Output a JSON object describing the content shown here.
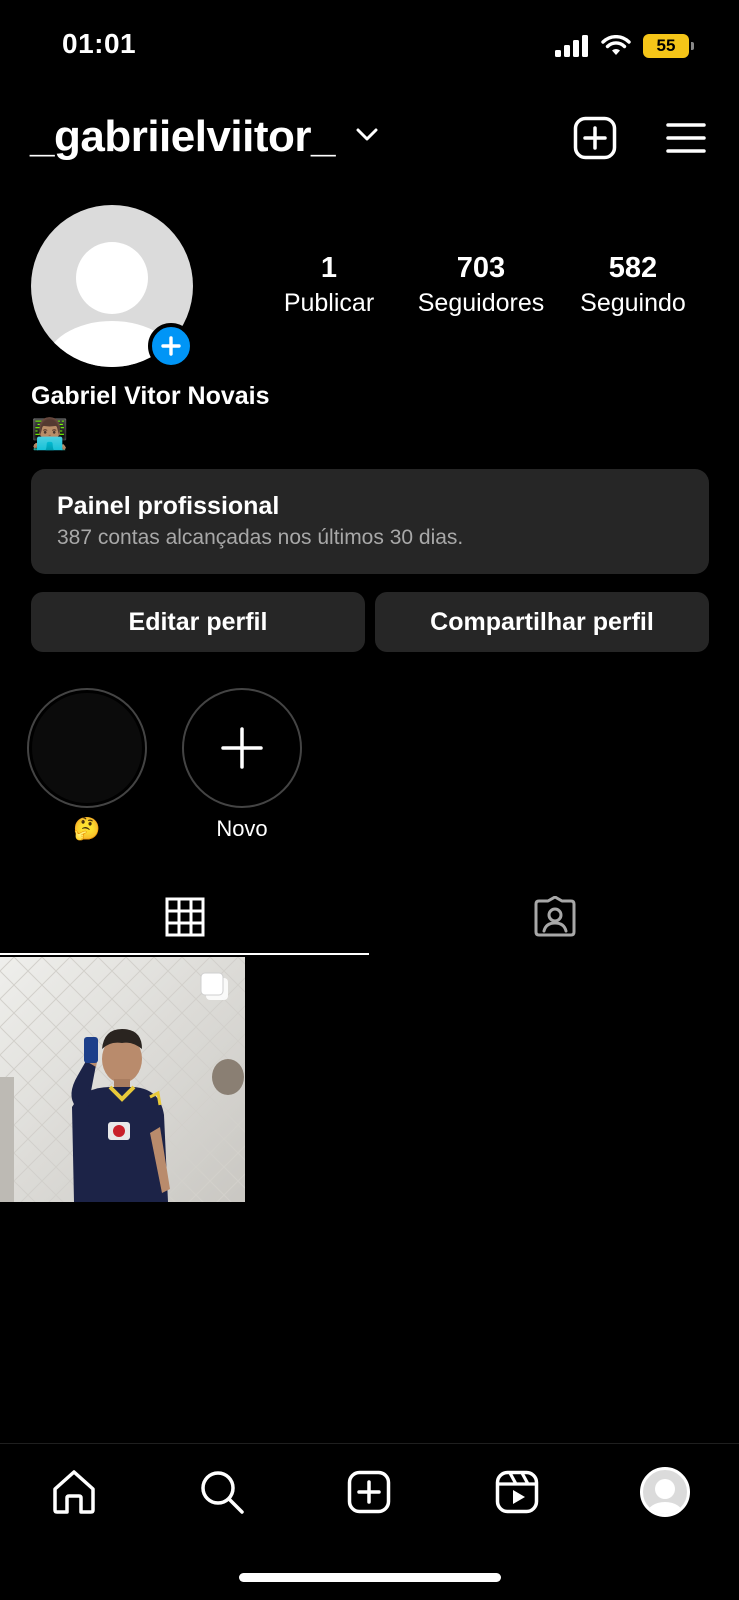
{
  "status_bar": {
    "time": "01:01",
    "battery": "55"
  },
  "header": {
    "username": "_gabriielviitor_"
  },
  "profile": {
    "name": "Gabriel Vitor Novais",
    "bio": "👨🏽‍💻",
    "stats": [
      {
        "value": "1",
        "label": "Publicar"
      },
      {
        "value": "703",
        "label": "Seguidores"
      },
      {
        "value": "582",
        "label": "Seguindo"
      }
    ]
  },
  "panel": {
    "title": "Painel profissional",
    "subtitle": "387 contas alcançadas nos últimos 30 dias."
  },
  "buttons": {
    "edit": "Editar perfil",
    "share": "Compartilhar perfil"
  },
  "highlights": [
    {
      "label": "🤔"
    },
    {
      "label": "Novo"
    }
  ],
  "tabs": [
    {
      "icon": "grid-icon",
      "active": true
    },
    {
      "icon": "tagged-icon",
      "active": false
    }
  ],
  "nav": [
    "home-icon",
    "search-icon",
    "create-icon",
    "reels-icon",
    "profile-avatar"
  ],
  "colors": {
    "accent": "#0095f6",
    "surface": "#262626",
    "battery": "#f5c518"
  }
}
